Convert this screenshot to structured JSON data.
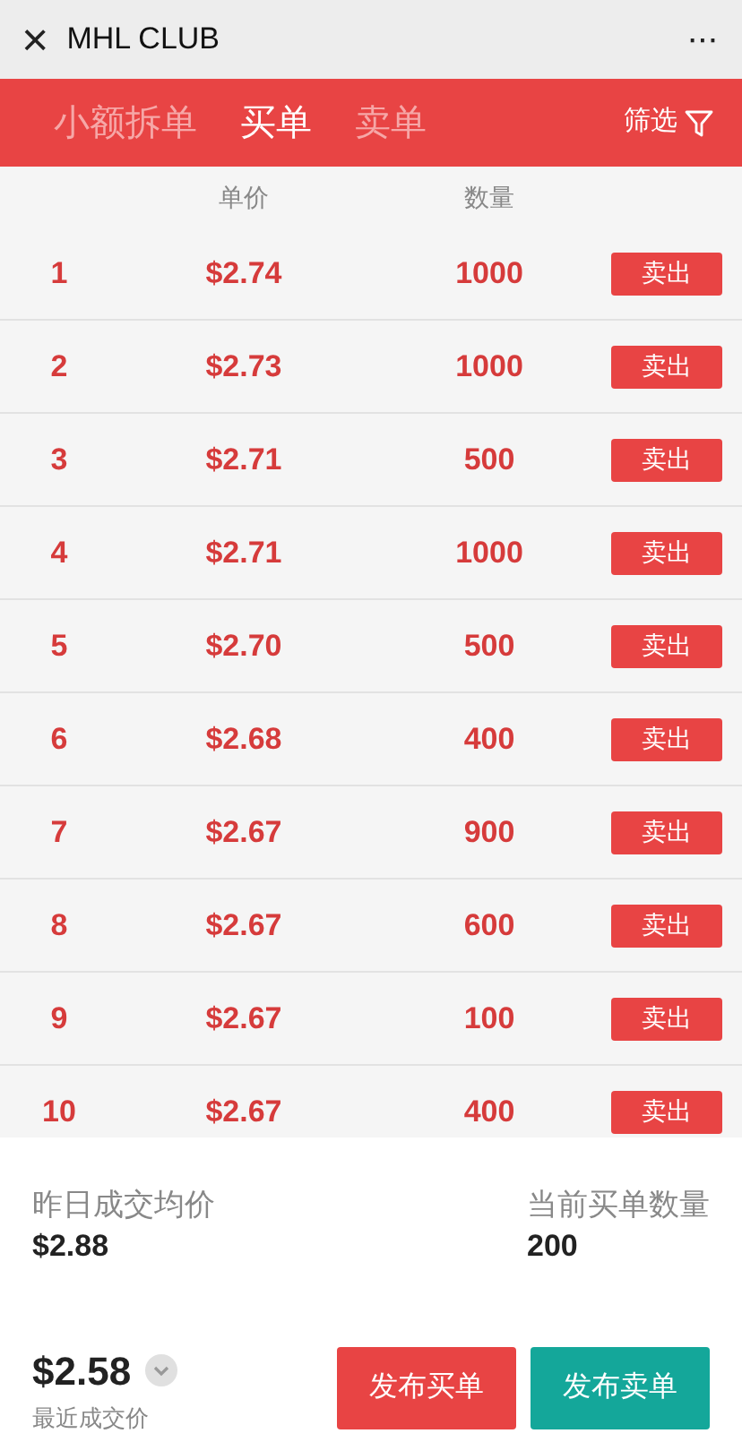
{
  "window": {
    "title": "MHL CLUB",
    "close": "×",
    "more": "···"
  },
  "tabs": [
    {
      "label": "小额拆单",
      "selected": false
    },
    {
      "label": "买单",
      "selected": true
    },
    {
      "label": "卖单",
      "selected": false
    }
  ],
  "filter": {
    "label": "筛选"
  },
  "table": {
    "columns": [
      "单价",
      "数量"
    ],
    "rows": [
      {
        "index": "1",
        "price": "$2.74",
        "quantity": "1000",
        "action": "卖出"
      },
      {
        "index": "2",
        "price": "$2.73",
        "quantity": "1000",
        "action": "卖出"
      },
      {
        "index": "3",
        "price": "$2.71",
        "quantity": "500",
        "action": "卖出"
      },
      {
        "index": "4",
        "price": "$2.71",
        "quantity": "1000",
        "action": "卖出"
      },
      {
        "index": "5",
        "price": "$2.70",
        "quantity": "500",
        "action": "卖出"
      },
      {
        "index": "6",
        "price": "$2.68",
        "quantity": "400",
        "action": "卖出"
      },
      {
        "index": "7",
        "price": "$2.67",
        "quantity": "900",
        "action": "卖出"
      },
      {
        "index": "8",
        "price": "$2.67",
        "quantity": "600",
        "action": "卖出"
      },
      {
        "index": "9",
        "price": "$2.67",
        "quantity": "100",
        "action": "卖出"
      },
      {
        "index": "10",
        "price": "$2.67",
        "quantity": "400",
        "action": "卖出"
      }
    ]
  },
  "stats": [
    {
      "label": "昨日成交均价",
      "value": "$2.88"
    },
    {
      "label": "当前买单数量",
      "value": "200"
    }
  ],
  "last_price": {
    "value": "$2.58",
    "label": "最近成交价"
  },
  "buttons": [
    {
      "label": "发布买单",
      "kind": "buy"
    },
    {
      "label": "发布卖单",
      "kind": "sell"
    }
  ]
}
